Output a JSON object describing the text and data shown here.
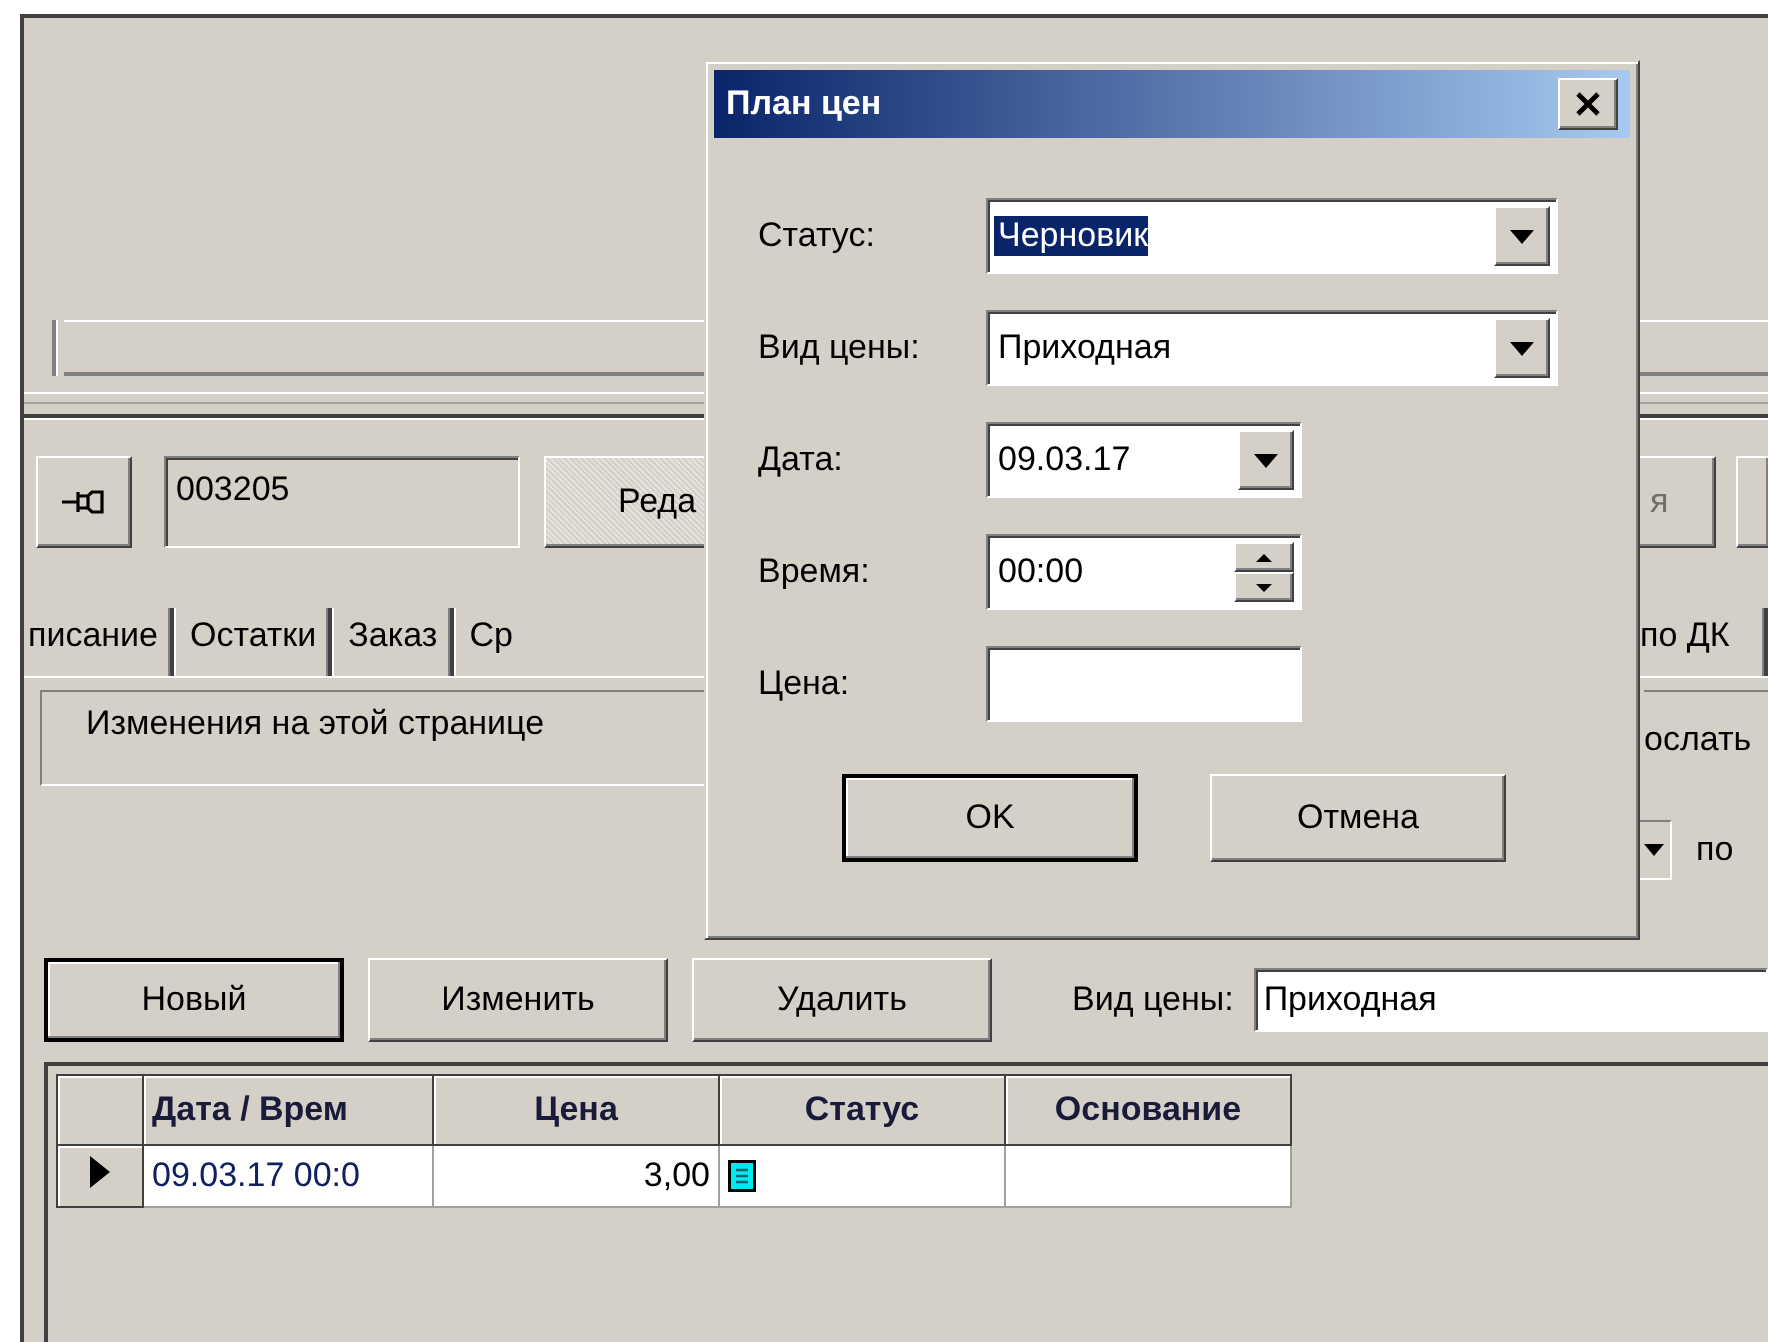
{
  "background": {
    "record_id": "003205",
    "toolbar_buttons": [
      {
        "label": "Реда",
        "disabled": false
      },
      {
        "label": "я",
        "disabled": true
      }
    ],
    "tabs": [
      {
        "label": "писание"
      },
      {
        "label": "Остатки"
      },
      {
        "label": "Заказ"
      },
      {
        "label": "Ср"
      },
      {
        "label": "по ДК"
      }
    ],
    "info_panel": "Изменения на этой странице",
    "right_label": "ослать",
    "filter_label": "по",
    "actions": [
      {
        "label": "Новый",
        "default": true
      },
      {
        "label": "Изменить",
        "default": false
      },
      {
        "label": "Удалить",
        "default": false
      }
    ],
    "price_type": {
      "label": "Вид цены:",
      "value": "Приходная"
    },
    "grid": {
      "columns": [
        "Дата / Врем",
        "Цена",
        "Статус",
        "Основание"
      ],
      "rows": [
        {
          "current": true,
          "date": "09.03.17 00:0",
          "price": "3,00",
          "status_icon": true
        }
      ]
    }
  },
  "dialog": {
    "title": "План цен",
    "fields": [
      {
        "kind": "combo",
        "label": "Статус:",
        "value": "Черновик",
        "highlighted": true
      },
      {
        "kind": "combo",
        "label": "Вид цены:",
        "value": "Приходная",
        "highlighted": false
      },
      {
        "kind": "date",
        "label": "Дата:",
        "value": "09.03.17",
        "highlighted": false
      },
      {
        "kind": "spin",
        "label": "Время:",
        "value": "00:00",
        "highlighted": false
      },
      {
        "kind": "edit",
        "label": "Цена:"
      }
    ],
    "buttons": [
      {
        "label": "OK",
        "default": true
      },
      {
        "label": "Отмена",
        "default": false
      }
    ]
  }
}
